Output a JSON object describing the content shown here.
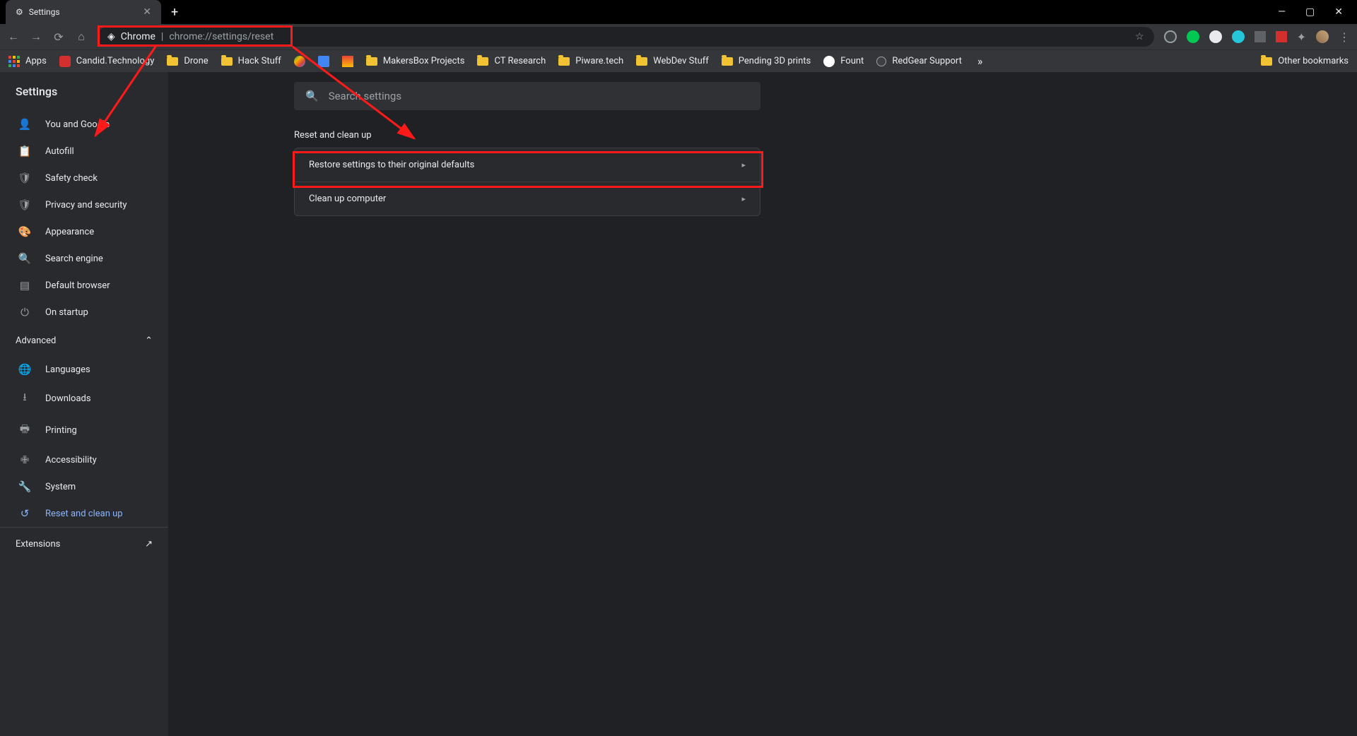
{
  "tab": {
    "title": "Settings"
  },
  "address": {
    "chrome_label": "Chrome",
    "path": "chrome://settings/reset"
  },
  "bookmarks": {
    "apps": "Apps",
    "items": [
      {
        "label": "Candid.Technology",
        "type": "link"
      },
      {
        "label": "Drone",
        "type": "folder"
      },
      {
        "label": "Hack Stuff",
        "type": "folder"
      },
      {
        "label": "MakersBox Projects",
        "type": "folder"
      },
      {
        "label": "CT Research",
        "type": "folder"
      },
      {
        "label": "Piware.tech",
        "type": "folder"
      },
      {
        "label": "WebDev Stuff",
        "type": "folder"
      },
      {
        "label": "Pending 3D prints",
        "type": "folder"
      },
      {
        "label": "Fount",
        "type": "link"
      },
      {
        "label": "RedGear Support",
        "type": "link"
      }
    ],
    "other": "Other bookmarks"
  },
  "sidebar": {
    "title": "Settings",
    "items": [
      {
        "label": "You and Google",
        "icon": "person"
      },
      {
        "label": "Autofill",
        "icon": "clipboard"
      },
      {
        "label": "Safety check",
        "icon": "shield-check"
      },
      {
        "label": "Privacy and security",
        "icon": "shield"
      },
      {
        "label": "Appearance",
        "icon": "palette"
      },
      {
        "label": "Search engine",
        "icon": "search"
      },
      {
        "label": "Default browser",
        "icon": "browser"
      },
      {
        "label": "On startup",
        "icon": "power"
      }
    ],
    "advanced": "Advanced",
    "adv_items": [
      {
        "label": "Languages",
        "icon": "globe"
      },
      {
        "label": "Downloads",
        "icon": "download"
      },
      {
        "label": "Printing",
        "icon": "printer"
      },
      {
        "label": "Accessibility",
        "icon": "accessibility"
      },
      {
        "label": "System",
        "icon": "wrench"
      },
      {
        "label": "Reset and clean up",
        "icon": "restore",
        "active": true
      }
    ],
    "extensions": "Extensions"
  },
  "content": {
    "search_placeholder": "Search settings",
    "section_title": "Reset and clean up",
    "rows": [
      {
        "label": "Restore settings to their original defaults"
      },
      {
        "label": "Clean up computer"
      }
    ]
  }
}
